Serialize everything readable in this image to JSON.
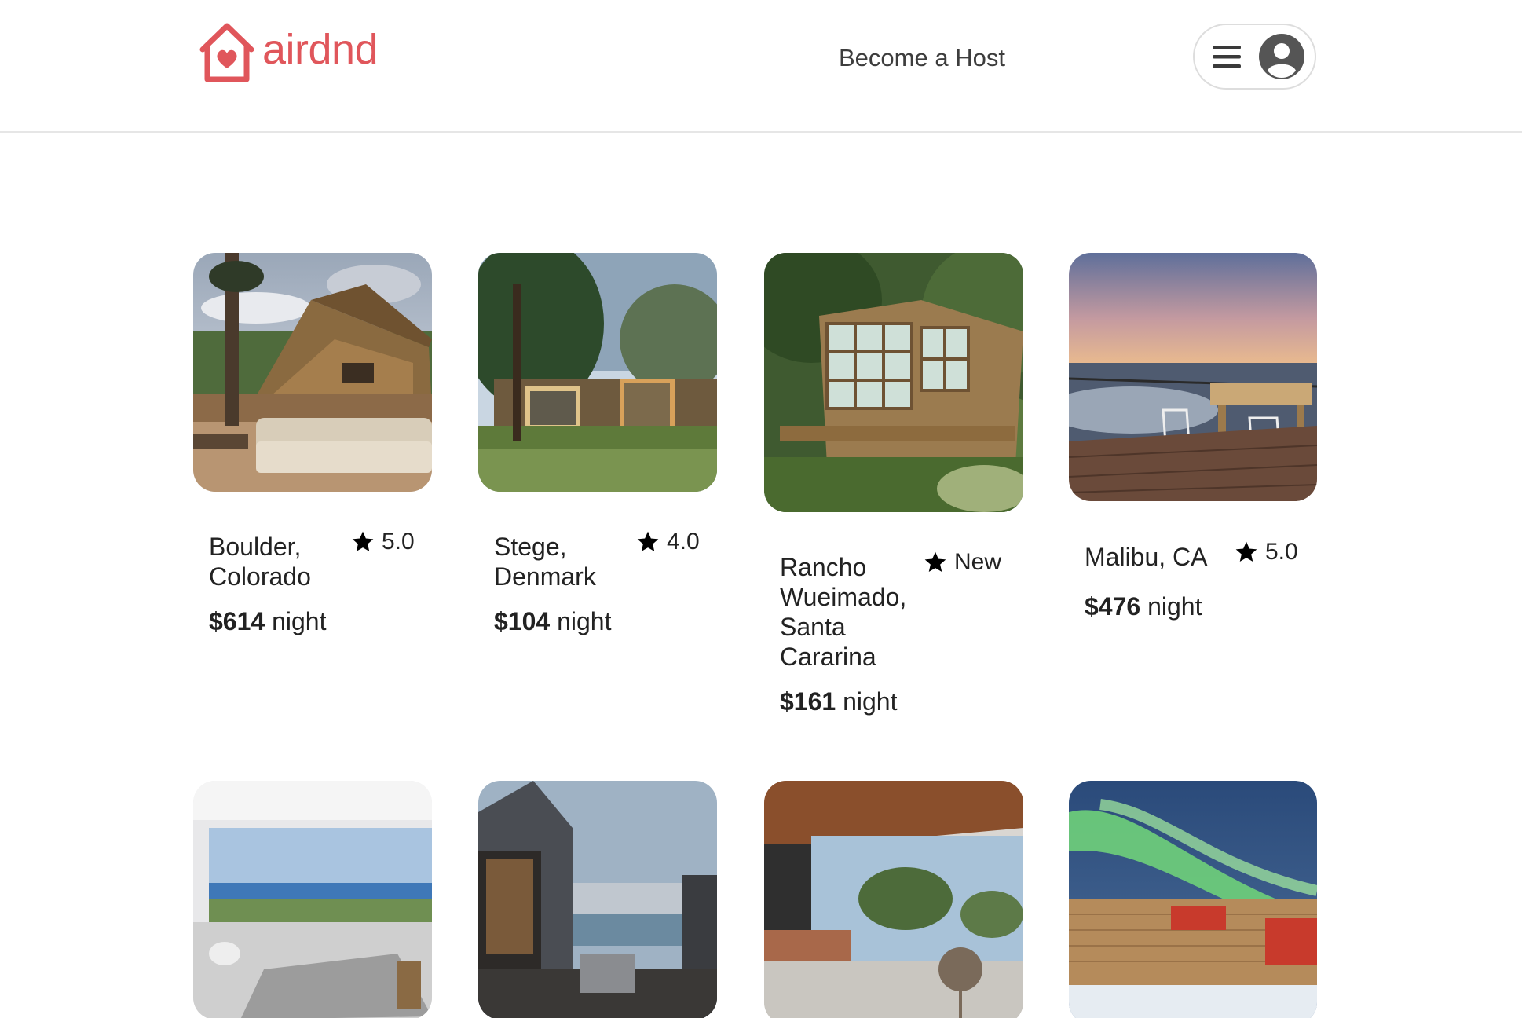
{
  "brand": {
    "name": "airdnd",
    "color": "#e0565b"
  },
  "nav": {
    "become_host": "Become a Host",
    "menu_icon": "hamburger-icon",
    "avatar_icon": "user-avatar-icon"
  },
  "listings": [
    {
      "location": "Boulder, Colorado",
      "rating": "5.0",
      "price": "$614",
      "unit": "night",
      "image": "mountain-cabin-deck"
    },
    {
      "location": "Stege, Denmark",
      "rating": "4.0",
      "price": "$104",
      "unit": "night",
      "image": "wooden-house-forest"
    },
    {
      "location": "Rancho Wueimado, Santa Cararina",
      "rating": "New",
      "price": "$161",
      "unit": "night",
      "image": "glass-treehouse"
    },
    {
      "location": "Malibu, CA",
      "rating": "5.0",
      "price": "$476",
      "unit": "night",
      "image": "ocean-deck-sunset"
    },
    {
      "image": "modern-living-room-ocean-view"
    },
    {
      "image": "grey-modern-house-patio"
    },
    {
      "image": "bedroom-wood-ceiling-view"
    },
    {
      "image": "cabin-northern-lights"
    }
  ]
}
